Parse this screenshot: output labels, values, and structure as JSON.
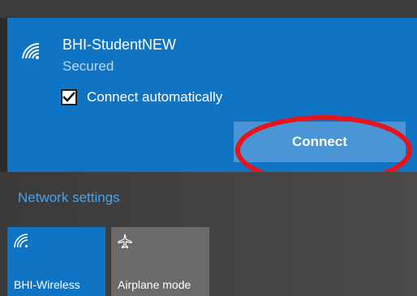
{
  "network": {
    "name": "BHI-StudentNEW",
    "status": "Secured",
    "connect_automatically_label": "Connect automatically",
    "connect_automatically_checked": true,
    "connect_label": "Connect"
  },
  "settings": {
    "network_settings_label": "Network settings"
  },
  "quick_actions": [
    {
      "label": "BHI-Wireless",
      "icon": "wifi-icon",
      "active": true
    },
    {
      "label": "Airplane mode",
      "icon": "airplane-icon",
      "active": false
    }
  ],
  "colors": {
    "accent": "#0f74c4",
    "highlight": "#e8141c",
    "link": "#4aa3e8"
  }
}
